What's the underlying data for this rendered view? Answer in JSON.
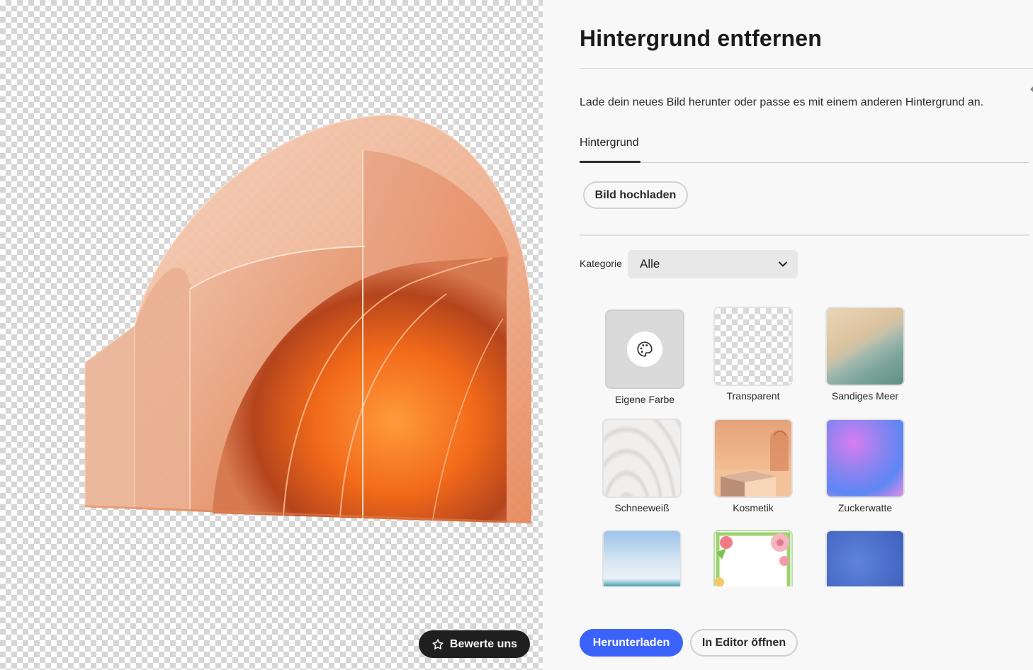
{
  "canvas": {
    "rate_button": {
      "label": "Bewerte uns",
      "icon": "star-outline-icon"
    }
  },
  "panel": {
    "title": "Hintergrund entfernen",
    "description": "Lade dein neues Bild herunter oder passe es mit einem anderen Hintergrund an.",
    "tabs": [
      {
        "label": "Hintergrund",
        "active": true
      }
    ],
    "upload_button": "Bild hochladen",
    "category": {
      "label": "Kategorie",
      "selected": "Alle",
      "icon": "chevron-down-icon"
    },
    "backgrounds": [
      {
        "label": "Eigene Farbe",
        "icon": "palette-icon"
      },
      {
        "label": "Transparent"
      },
      {
        "label": "Sandiges Meer"
      },
      {
        "label": "Schneeweiß"
      },
      {
        "label": "Kosmetik"
      },
      {
        "label": "Zuckerwatte"
      },
      {
        "label": ""
      },
      {
        "label": ""
      },
      {
        "label": ""
      }
    ],
    "actions": {
      "download": "Herunterladen",
      "open_editor": "In Editor öffnen"
    },
    "colors": {
      "accent": "#3b63fb",
      "panel_bg": "#f8f8f8",
      "dark_button": "#1f1f1f"
    }
  }
}
